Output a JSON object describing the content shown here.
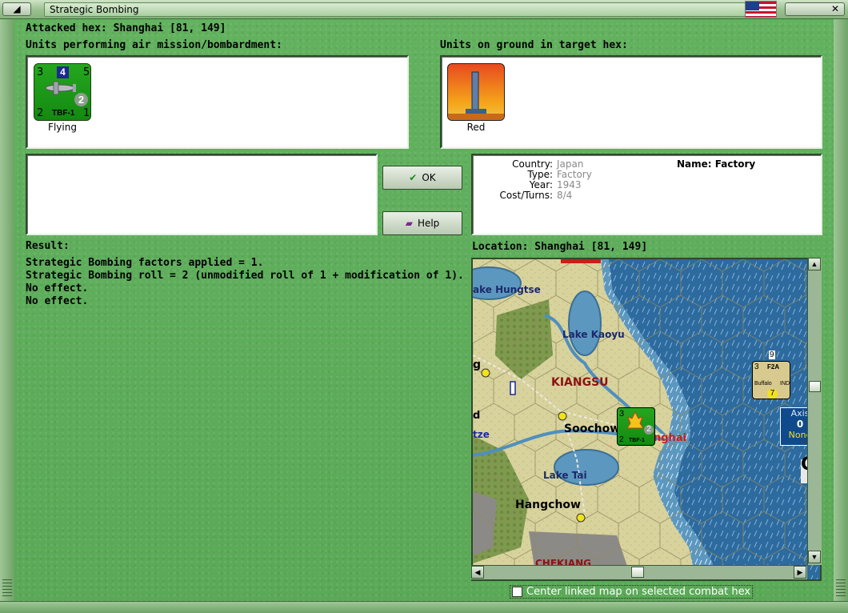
{
  "window": {
    "title": "Strategic Bombing",
    "restore_glyph": "◢",
    "close_glyph": "✕",
    "flag_icon": "us-flag-icon"
  },
  "attacked_hex": "Attacked hex: Shanghai  [81, 149]",
  "air_units": {
    "label": "Units performing air mission/bombardment:",
    "unit": {
      "tl": "3",
      "box": "4",
      "tr": "5",
      "circle": "2",
      "code": "TBF-1",
      "bl": "2",
      "br": "1",
      "caption": "Flying",
      "color": "#1f9e1a"
    }
  },
  "ground_units": {
    "label": "Units on ground in target hex:",
    "caption": "Red"
  },
  "buttons": {
    "ok": "OK",
    "help": "Help"
  },
  "target_info": {
    "country_key": "Country:",
    "country": "Japan",
    "type_key": "Type:",
    "type": "Factory",
    "year_key": "Year:",
    "year": "1943",
    "cost_key": "Cost/Turns:",
    "cost": "8/4",
    "name": "Name: Factory"
  },
  "result": {
    "label": "Result:",
    "lines": [
      "Strategic Bombing factors applied = 1.",
      "Strategic Bombing roll = 2 (unmodified roll of 1 + modification of 1).",
      "No effect.",
      "No effect."
    ]
  },
  "location": "Location:  Shanghai  [81, 149]",
  "map": {
    "labels": {
      "lake_hungtse": "ake Hungtse",
      "lake_kaoyu": "Lake Kaoyu",
      "kiangsu": "KIANGSU",
      "soochow": "Soochow",
      "shanghai": "nghai",
      "lake_tai": "Lake Tai",
      "hangchow": "Hangchow",
      "chekiang": "CHEKIANG",
      "edge_g": "g",
      "edge_d": "d",
      "edge_tze": "tze",
      "edge_c": "C"
    },
    "map_unit": {
      "tl": "3",
      "circle": "2",
      "bl": "2",
      "code": "TBF-1"
    },
    "enemy_unit": {
      "stack": "9",
      "tl": "3",
      "type": "F2A",
      "name": "Buffalo",
      "tag": "IND",
      "value": "7"
    },
    "axis_box": {
      "title": "Axis",
      "value": "0",
      "status": "None"
    }
  },
  "center_check": {
    "label": "Center linked map on selected combat hex",
    "checked": false
  }
}
